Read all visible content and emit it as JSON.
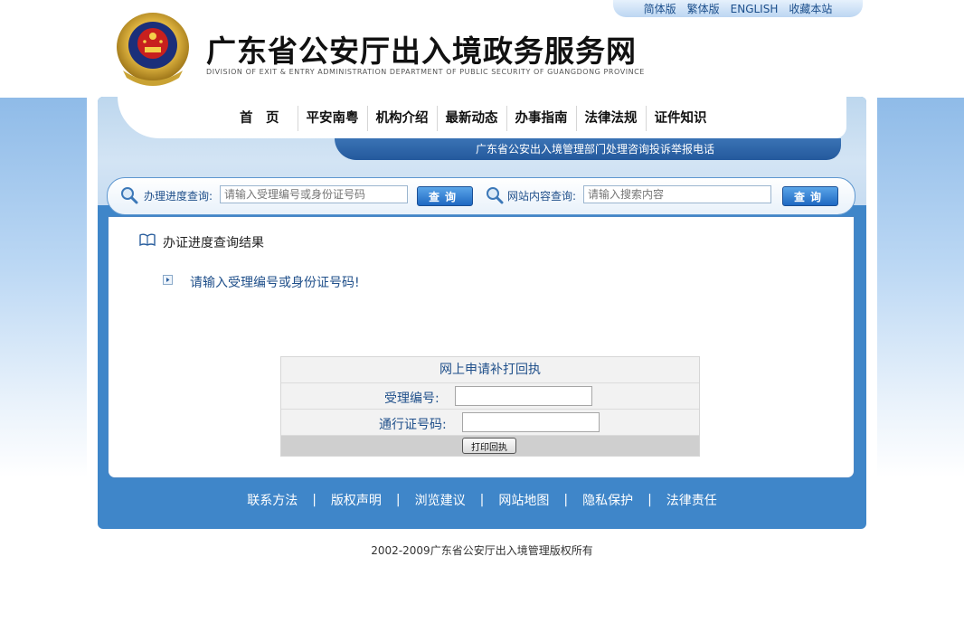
{
  "header": {
    "lang_links": [
      "简体版",
      "繁体版",
      "ENGLISH",
      "收藏本站"
    ],
    "title": "广东省公安厅出入境政务服务网",
    "subtitle": "DIVISION OF EXIT & ENTRY ADMINISTRATION DEPARTMENT OF PUBLIC SECURITY OF GUANGDONG PROVINCE"
  },
  "nav": {
    "items": [
      "首　页",
      "平安南粤",
      "机构介绍",
      "最新动态",
      "办事指南",
      "法律法规",
      "证件知识"
    ]
  },
  "notice": "广东省公安出入境管理部门处理咨询投诉举报电话",
  "search": {
    "progress_label": "办理进度查询:",
    "progress_placeholder": "请输入受理编号或身份证号码",
    "progress_button": "查询",
    "site_label": "网站内容查询:",
    "site_placeholder": "请输入搜索内容",
    "site_button": "查询"
  },
  "content": {
    "title": "办证进度查询结果",
    "message": "请输入受理编号或身份证号码!"
  },
  "reprint_form": {
    "title": "网上申请补打回执",
    "field1_label": "受理编号:",
    "field1_value": "",
    "field2_label": "通行证号码:",
    "field2_value": "",
    "button": "打印回执"
  },
  "footer": {
    "links": [
      "联系方法",
      "版权声明",
      "浏览建议",
      "网站地图",
      "隐私保护",
      "法律责任"
    ],
    "separator": "|",
    "copyright": "2002-2009广东省公安厅出入境管理版权所有"
  },
  "colors": {
    "brand_blue": "#3f86c9",
    "dark_blue": "#24599d",
    "text_blue": "#1f4f8a"
  }
}
